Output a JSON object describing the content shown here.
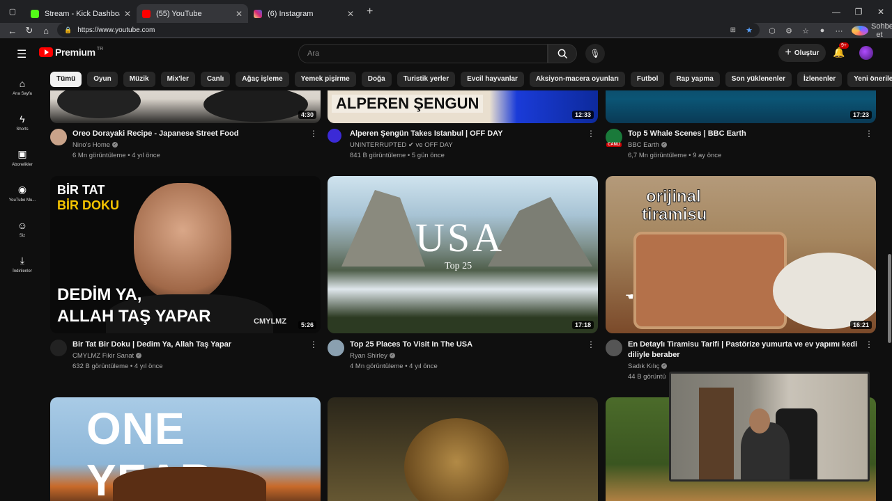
{
  "browser": {
    "tabs": [
      {
        "title": "Stream - Kick Dashboard",
        "color": "#53fc18",
        "active": false
      },
      {
        "title": "(55) YouTube",
        "color": "#ff0000",
        "active": true
      },
      {
        "title": "(6) Instagram",
        "color": "#d6249f",
        "active": false
      }
    ],
    "url": "https://www.youtube.com",
    "copilot_label": "Sohbet et"
  },
  "youtube": {
    "logo_text": "Premium",
    "logo_tr": "TR",
    "search_placeholder": "Ara",
    "create_label": "Oluştur",
    "notif_count": "9+",
    "sidebar": [
      {
        "label": "Ana Sayfa",
        "icon": "home-icon",
        "glyph": "⌂"
      },
      {
        "label": "Shorts",
        "icon": "shorts-icon",
        "glyph": "ϟ"
      },
      {
        "label": "Abonelikler",
        "icon": "subscriptions-icon",
        "glyph": "▣"
      },
      {
        "label": "YouTube Mu...",
        "icon": "music-icon",
        "glyph": "◉"
      },
      {
        "label": "Siz",
        "icon": "you-icon",
        "glyph": "☺"
      },
      {
        "label": "İndirilenler",
        "icon": "downloads-icon",
        "glyph": "⤓"
      }
    ],
    "chips": [
      "Tümü",
      "Oyun",
      "Müzik",
      "Mix'ler",
      "Canlı",
      "Ağaç işleme",
      "Yemek pişirme",
      "Doğa",
      "Turistik yerler",
      "Evcil hayvanlar",
      "Aksiyon-macera oyunları",
      "Futbol",
      "Rap yapma",
      "Son yüklenenler",
      "İzlenenler",
      "Yeni öneriler"
    ],
    "videos": [
      {
        "title": "Oreo Dorayaki Recipe - Japanese Street Food",
        "channel": "Nino's Home",
        "stats": "6 Mn görüntüleme • 4 yıl önce",
        "duration": "4:30",
        "avatar_color": "#c9a38a"
      },
      {
        "title": "Alperen Şengün Takes Istanbul | OFF DAY",
        "channel": "UNINTERRUPTED ✔ ve OFF DAY",
        "stats": "841 B görüntüleme • 5 gün önce",
        "duration": "12:33",
        "avatar_color": "#3b2ad6",
        "thumb_text": "ALPEREN ŞENGUN"
      },
      {
        "title": "Top 5 Whale Scenes | BBC Earth",
        "channel": "BBC Earth",
        "stats": "6,7 Mn görüntüleme • 9 ay önce",
        "duration": "17:23",
        "avatar_color": "#1a7a3a",
        "live": "CANLI"
      },
      {
        "title": "Bir Tat Bir Doku | Dedim Ya, Allah Taş Yapar",
        "channel": "CMYLMZ Fikir Sanat",
        "stats": "632 B görüntüleme • 4 yıl önce",
        "duration": "5:26",
        "avatar_color": "#222",
        "thumb_top": "BİR TAT",
        "thumb_top2": "BİR DOKU",
        "thumb_bottom": "DEDİM YA,",
        "thumb_bottom2": "ALLAH TAŞ YAPAR",
        "thumb_brand": "CMYLMZ"
      },
      {
        "title": "Top 25 Places To Visit In The USA",
        "channel": "Ryan Shirley",
        "stats": "4 Mn görüntüleme • 4 yıl önce",
        "duration": "17:18",
        "avatar_color": "#8aa0b0",
        "thumb_big": "USA",
        "thumb_sub": "Top 25"
      },
      {
        "title": "En Detaylı Tiramisu Tarifi | Pastörize yumurta ve ev yapımı kedi diliyle beraber",
        "channel": "Sadık Kılıç",
        "stats": "44 B görüntü",
        "duration": "16:21",
        "avatar_color": "#555",
        "thumb_text": "orijinal",
        "thumb_text2": "tiramisu"
      },
      {
        "title": "",
        "channel": "",
        "stats": "",
        "duration": "",
        "avatar_color": "#000",
        "thumb_big": "ONE YEAR"
      }
    ]
  }
}
